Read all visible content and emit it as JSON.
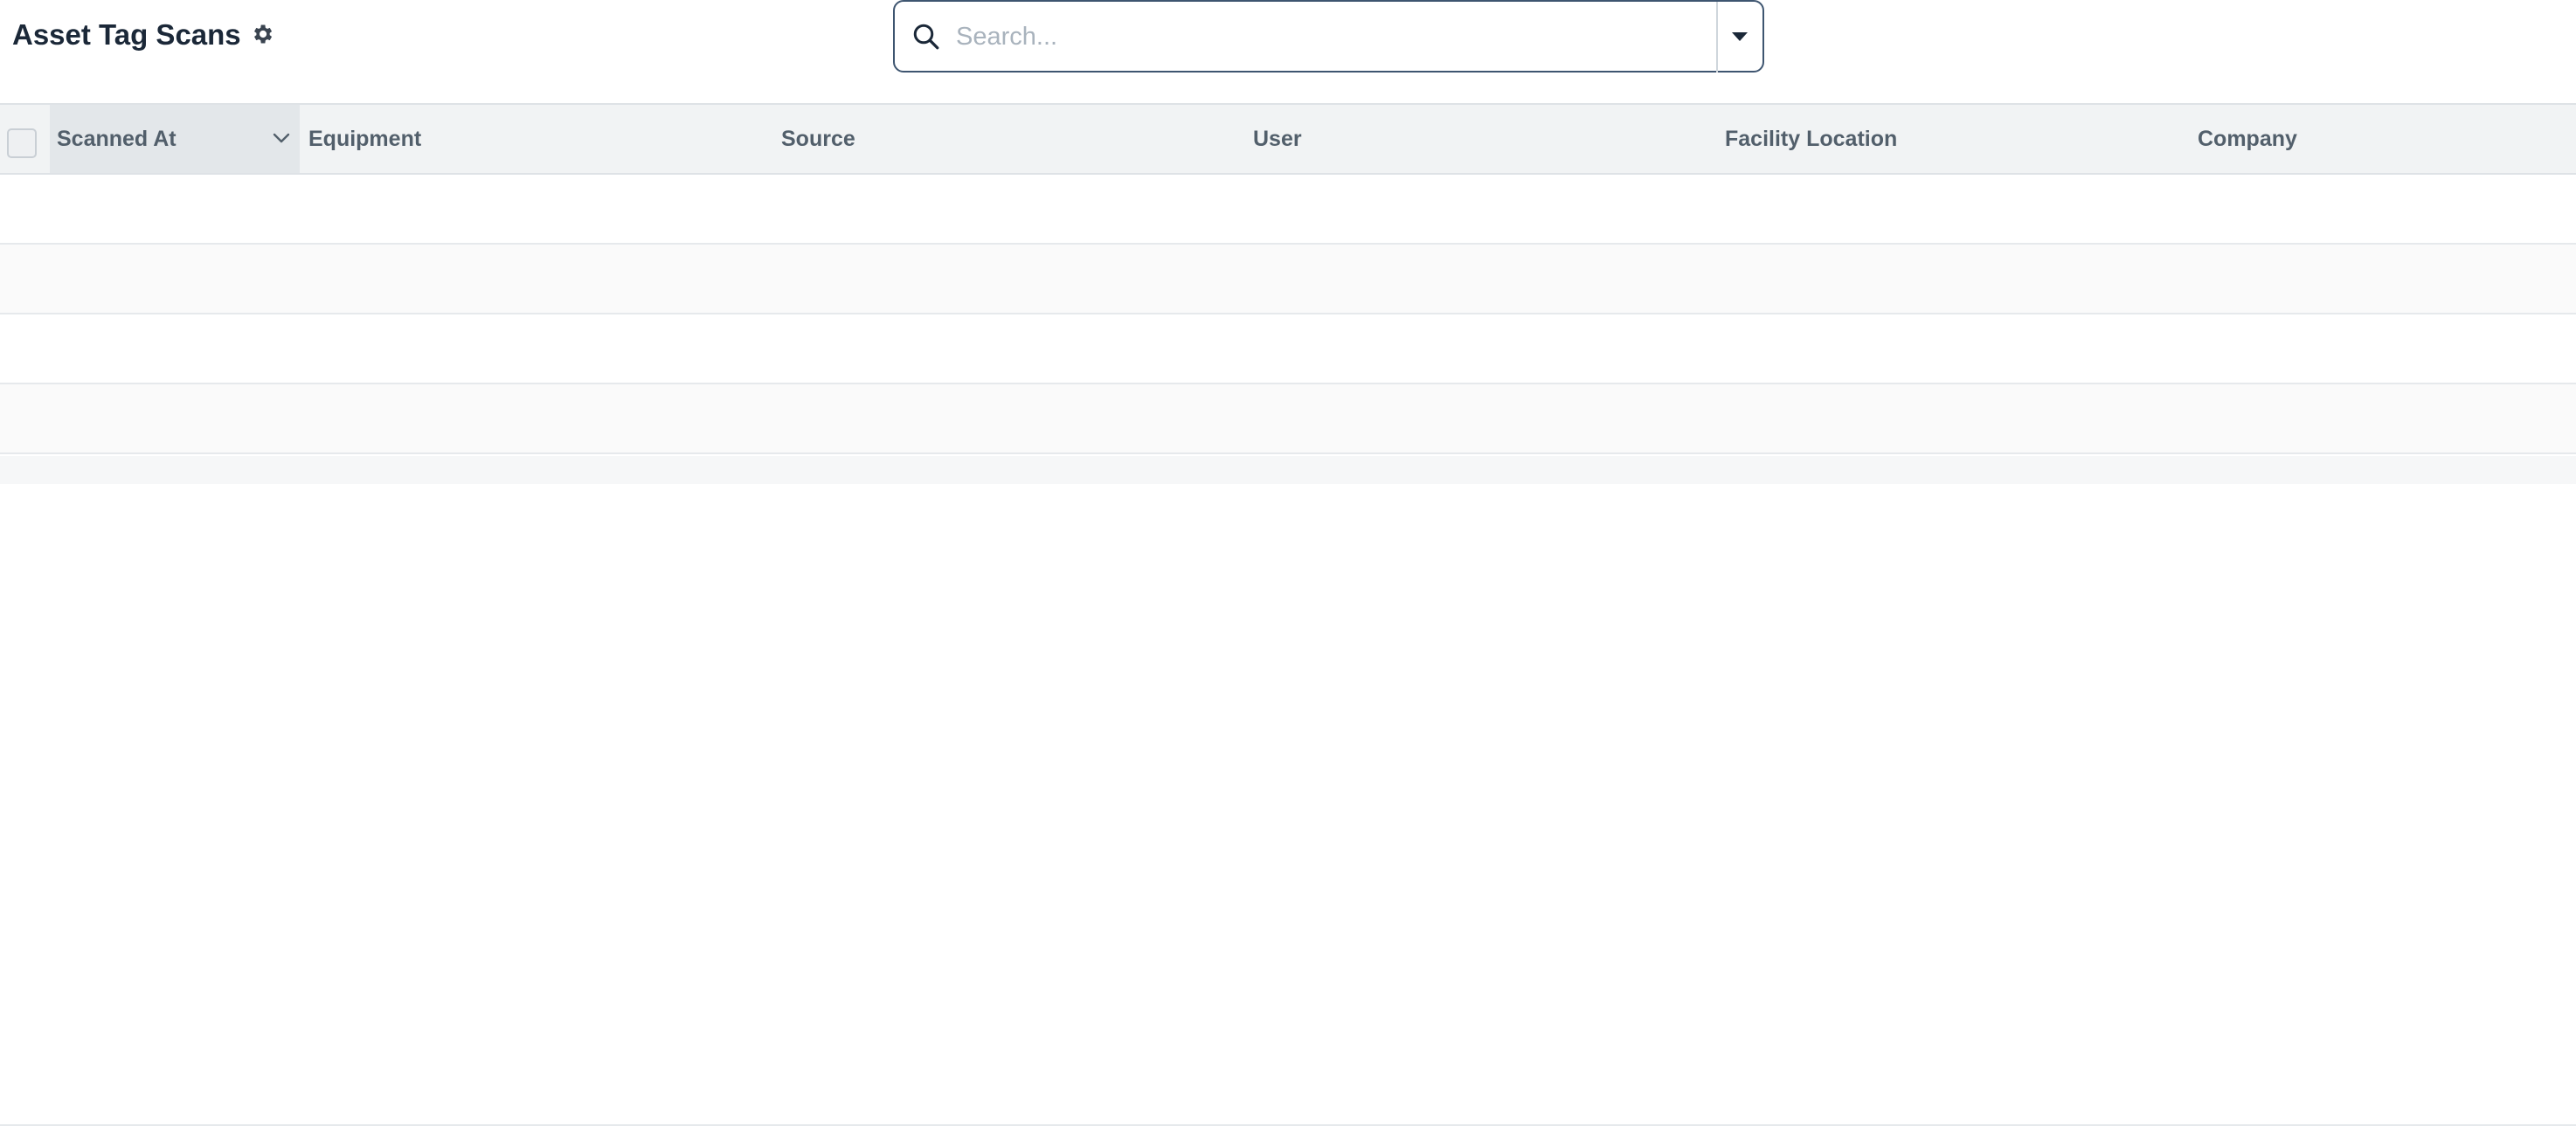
{
  "page": {
    "title": "Asset Tag Scans",
    "settings_icon": "gear-icon"
  },
  "search": {
    "placeholder": "Search...",
    "value": "",
    "icon": "search-icon",
    "dropdown_icon": "caret-down-icon"
  },
  "table": {
    "sorted_column": "Scanned At",
    "sort_icon": "chevron-down-icon",
    "columns": [
      "Scanned At",
      "Equipment",
      "Source",
      "User",
      "Facility Location",
      "Company"
    ],
    "rows": [
      [
        "",
        "",
        "",
        "",
        "",
        ""
      ],
      [
        "",
        "",
        "",
        "",
        "",
        ""
      ],
      [
        "",
        "",
        "",
        "",
        "",
        ""
      ],
      [
        "",
        "",
        "",
        "",
        "",
        ""
      ]
    ]
  },
  "colors": {
    "title": "#1b2838",
    "header_bg": "#f1f3f4",
    "header_text": "#525f6b",
    "search_border": "#3e5570"
  }
}
